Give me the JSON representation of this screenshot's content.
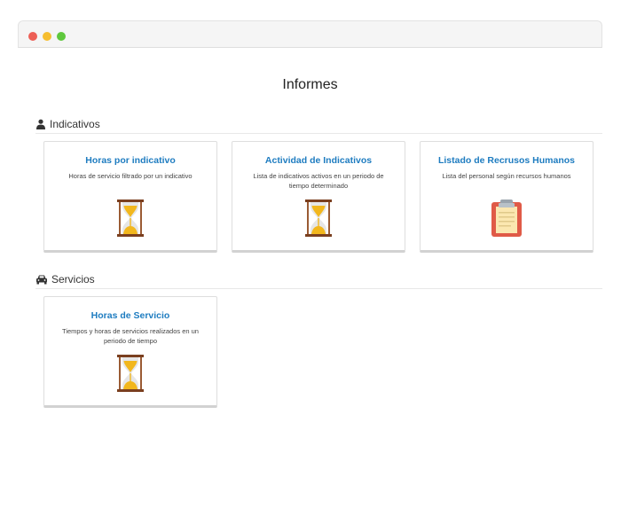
{
  "page": {
    "title": "Informes"
  },
  "sections": [
    {
      "name": "Indicativos",
      "icon": "user-icon",
      "cards": [
        {
          "title": "Horas por indicativo",
          "description": "Horas de servicio filtrado por un indicativo",
          "icon": "hourglass-icon"
        },
        {
          "title": "Actividad de Indicativos",
          "description": "Lista de indicativos activos en un periodo de tiempo determinado",
          "icon": "hourglass-icon"
        },
        {
          "title": "Listado de Recrusos Humanos",
          "description": "Lista del personal según recursos humanos",
          "icon": "clipboard-icon"
        }
      ]
    },
    {
      "name": "Servicios",
      "icon": "car-icon",
      "cards": [
        {
          "title": "Horas de Servicio",
          "description": "Tiempos y horas de servicios realizados en un periodo de tiempo",
          "icon": "hourglass-icon"
        }
      ]
    }
  ],
  "colors": {
    "accent": "#1e7cc0",
    "hourglass": "#f2b71d",
    "clipboard": "#e05a47"
  }
}
